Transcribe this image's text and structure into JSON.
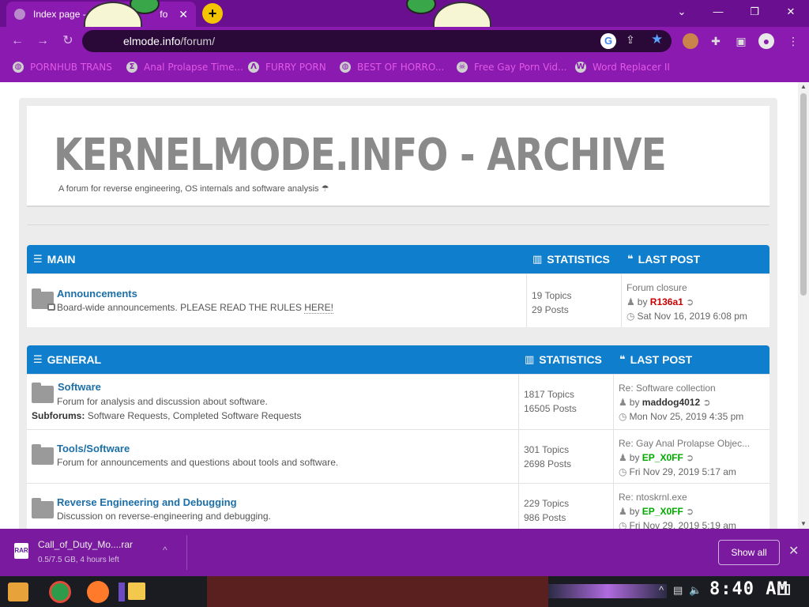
{
  "browser": {
    "tab_title": "Index page - K",
    "tab_title_tail": "fo",
    "address_host": "elmode.info",
    "address_path": "/forum/",
    "bookmarks": [
      {
        "label": "PORNHUB TRANS",
        "icon": "globe-icon"
      },
      {
        "label": "Anal Prolapse Time...",
        "icon": "sigma-icon"
      },
      {
        "label": "FURRY PORN",
        "icon": "lambda-icon"
      },
      {
        "label": "BEST OF HORRO...",
        "icon": "globe-icon"
      },
      {
        "label": "Free Gay Porn Vid...",
        "icon": "skull-icon"
      },
      {
        "label": "Word Replacer II",
        "icon": "wr-icon"
      }
    ]
  },
  "site": {
    "title": "KERNELMODE.INFO - ARCHIVE",
    "description": "A forum for reverse engineering, OS internals and software analysis ☂"
  },
  "categories": [
    {
      "name": "MAIN",
      "stats_label": "STATISTICS",
      "last_label": "LAST POST",
      "forums": [
        {
          "title": "Announcements",
          "description": "Board-wide announcements. PLEASE READ THE RULES ",
          "description_link": "HERE!",
          "topics": "19 Topics",
          "posts": "29 Posts",
          "last_title": "Forum closure",
          "last_user": "R136a1",
          "last_user_color": "#cc0000",
          "last_date": "Sat Nov 16, 2019 6:08 pm",
          "locked": true
        }
      ]
    },
    {
      "name": "GENERAL",
      "stats_label": "STATISTICS",
      "last_label": "LAST POST",
      "forums": [
        {
          "title": "Software",
          "description": "Forum for analysis and discussion about software.",
          "subforums_label": "Subforums:",
          "subforums": "Software Requests, Completed Software Requests",
          "topics": "1817 Topics",
          "posts": "16505 Posts",
          "last_title": "Re: Software collection",
          "last_user": "maddog4012",
          "last_user_color": "#333333",
          "last_date": "Mon Nov 25, 2019 4:35 pm"
        },
        {
          "title": "Tools/Software",
          "description": "Forum for announcements and questions about tools and software.",
          "topics": "301 Topics",
          "posts": "2698 Posts",
          "last_title": "Re: Gay Anal Prolapse Objec...",
          "last_user": "EP_X0FF",
          "last_user_color": "#00aa00",
          "last_date": "Fri Nov 29, 2019 5:17 am"
        },
        {
          "title": "Reverse Engineering and Debugging",
          "description": "Discussion on reverse-engineering and debugging.",
          "topics": "229 Topics",
          "posts": "986 Posts",
          "last_title": "Re: ntoskrnl.exe",
          "last_user": "EP_X0FF",
          "last_user_color": "#00aa00",
          "last_date": "Fri Nov 29, 2019 5:19 am"
        }
      ]
    }
  ],
  "download": {
    "filename": "Call_of_Duty_Mo....rar",
    "status": "0.5/7.5 GB, 4 hours left",
    "show_all": "Show all"
  },
  "taskbar": {
    "clock": "8:40 AM"
  },
  "common": {
    "by": "by"
  }
}
